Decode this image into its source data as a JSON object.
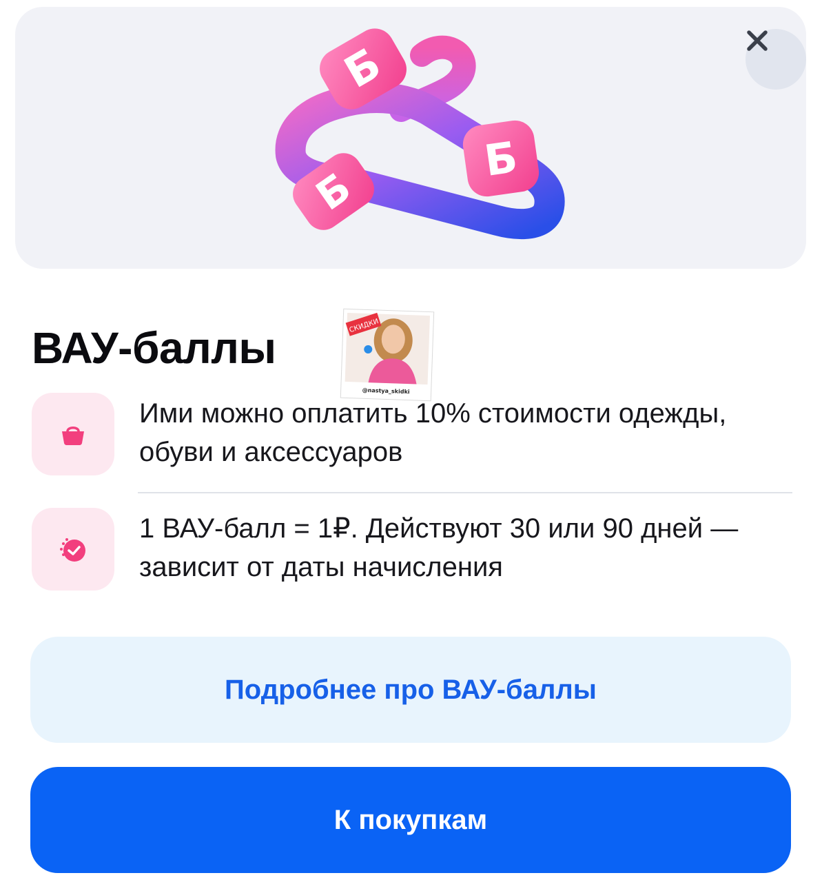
{
  "sheet": {
    "title": "ВАУ-баллы",
    "close_icon": "close-icon",
    "hero_icon": "hanger-with-b-coins",
    "sticker": {
      "badge": "СКИДКИ",
      "handle": "@nastya_skidki"
    }
  },
  "features": [
    {
      "icon": "shopping-bag-icon",
      "text": "Ими можно оплатить 10% стоимости одежды, обуви и аксессуаров"
    },
    {
      "icon": "timer-check-icon",
      "text": "1 ВАУ-балл = 1₽. Действуют 30 или 90 дней — зависит от даты начисления"
    }
  ],
  "buttons": {
    "details": "Подробнее про ВАУ-баллы",
    "shop": "К покупкам"
  },
  "colors": {
    "accent_blue": "#0a63f5",
    "accent_pink": "#f23f7e",
    "hero_bg": "#f1f2f7",
    "secondary_bg": "#e8f4fd"
  }
}
